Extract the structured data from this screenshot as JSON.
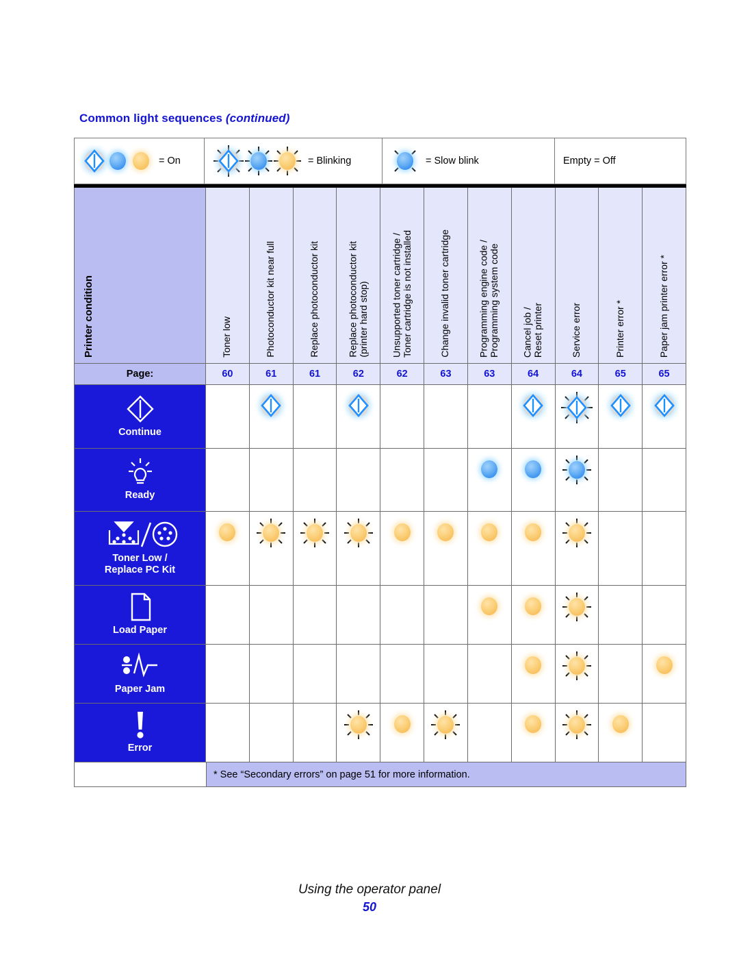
{
  "header": {
    "title_main": "Common light sequences ",
    "title_italic": "(continued)"
  },
  "legend": {
    "items": [
      {
        "label": "= On",
        "icons": [
          "diamond-on",
          "blue-dot-on",
          "amber-dot-on"
        ]
      },
      {
        "label": "= Blinking",
        "icons": [
          "diamond-blinking",
          "blue-dot-blinking",
          "amber-dot-blinking"
        ]
      },
      {
        "label": "= Slow blink",
        "icons": [
          "blue-dot-slow-blink"
        ]
      },
      {
        "label": "Empty = Off",
        "icons": []
      }
    ]
  },
  "table": {
    "condition_header": "Printer condition",
    "page_label": "Page:",
    "columns": [
      {
        "header": "Toner low",
        "page": "60"
      },
      {
        "header": "Photoconductor kit near full",
        "page": "61"
      },
      {
        "header": "Replace photoconductor kit",
        "page": "61"
      },
      {
        "header": "Replace photoconductor kit\n(printer hard stop)",
        "page": "62"
      },
      {
        "header": "Unsupported toner cartridge /\nToner cartridge is not installed",
        "page": "62"
      },
      {
        "header": "Change invalid toner cartridge",
        "page": "63"
      },
      {
        "header": "Programming engine code /\nProgramming system code",
        "page": "63"
      },
      {
        "header": "Cancel job /\nReset printer",
        "page": "64"
      },
      {
        "header": "Service error",
        "page": "64"
      },
      {
        "header": "Printer error *",
        "page": "65"
      },
      {
        "header": "Paper jam printer error *",
        "page": "65"
      }
    ],
    "rows": [
      {
        "label": "Continue",
        "icon": "continue-diamond-icon",
        "type": "diamond",
        "states": [
          "off",
          "on",
          "off",
          "on",
          "off",
          "off",
          "off",
          "on",
          "blink",
          "on",
          "on"
        ]
      },
      {
        "label": "Ready",
        "icon": "ready-lightbulb-icon",
        "type": "blue",
        "states": [
          "off",
          "off",
          "off",
          "off",
          "off",
          "off",
          "on",
          "on",
          "blink",
          "off",
          "off"
        ]
      },
      {
        "label": "Toner Low /\nReplace PC Kit",
        "icon": "toner-low-replace-pc-kit-icon",
        "type": "amber",
        "states": [
          "on",
          "blink",
          "blink",
          "blink",
          "on",
          "on",
          "on",
          "on",
          "blink",
          "off",
          "off"
        ]
      },
      {
        "label": "Load Paper",
        "icon": "load-paper-icon",
        "type": "amber",
        "states": [
          "off",
          "off",
          "off",
          "off",
          "off",
          "off",
          "on",
          "on",
          "blink",
          "off",
          "off"
        ]
      },
      {
        "label": "Paper Jam",
        "icon": "paper-jam-icon",
        "type": "amber",
        "states": [
          "off",
          "off",
          "off",
          "off",
          "off",
          "off",
          "off",
          "on",
          "blink",
          "off",
          "on"
        ]
      },
      {
        "label": "Error",
        "icon": "error-exclamation-icon",
        "type": "amber",
        "states": [
          "off",
          "off",
          "off",
          "blink",
          "on",
          "blink",
          "off",
          "on",
          "blink",
          "on",
          "off"
        ]
      }
    ],
    "footnote": "* See “Secondary errors” on page 51 for more information."
  },
  "footer": {
    "title": "Using the operator panel",
    "page_number": "50"
  },
  "colors": {
    "accent_blue": "#1414d2",
    "panel_blue": "#1a19d9",
    "header_lavender": "#b9bdf2",
    "cell_lavender": "#e4e6fb",
    "amber": "#f7bf5d",
    "blue_led": "#3d93ef"
  }
}
